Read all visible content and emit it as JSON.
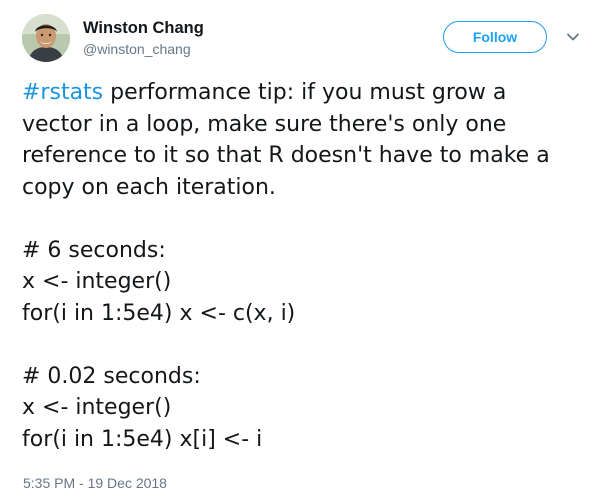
{
  "author": {
    "display_name": "Winston Chang",
    "handle": "@winston_chang"
  },
  "follow_button": {
    "label": "Follow"
  },
  "icons": {
    "avatar": "avatar-photo",
    "menu": "chevron-down-icon"
  },
  "tweet": {
    "hashtag": "#rstats",
    "intro_rest": " performance tip: if you must grow a vector in a loop, make sure there's only one reference to it so that R doesn't have to make a copy on each iteration.",
    "code_block_1": {
      "comment": "# 6 seconds:",
      "line_1": "x <- integer()",
      "line_2": "for(i in 1:5e4) x <- c(x, i)"
    },
    "code_block_2": {
      "comment": "# 0.02 seconds:",
      "line_1": "x <- integer()",
      "line_2": "for(i in 1:5e4) x[i] <- i"
    }
  },
  "timestamp": "5:35 PM - 19 Dec 2018",
  "colors": {
    "link": "#1b95e0",
    "follow_accent": "#1da1f2",
    "secondary_text": "#657786",
    "primary_text": "#14171a"
  }
}
